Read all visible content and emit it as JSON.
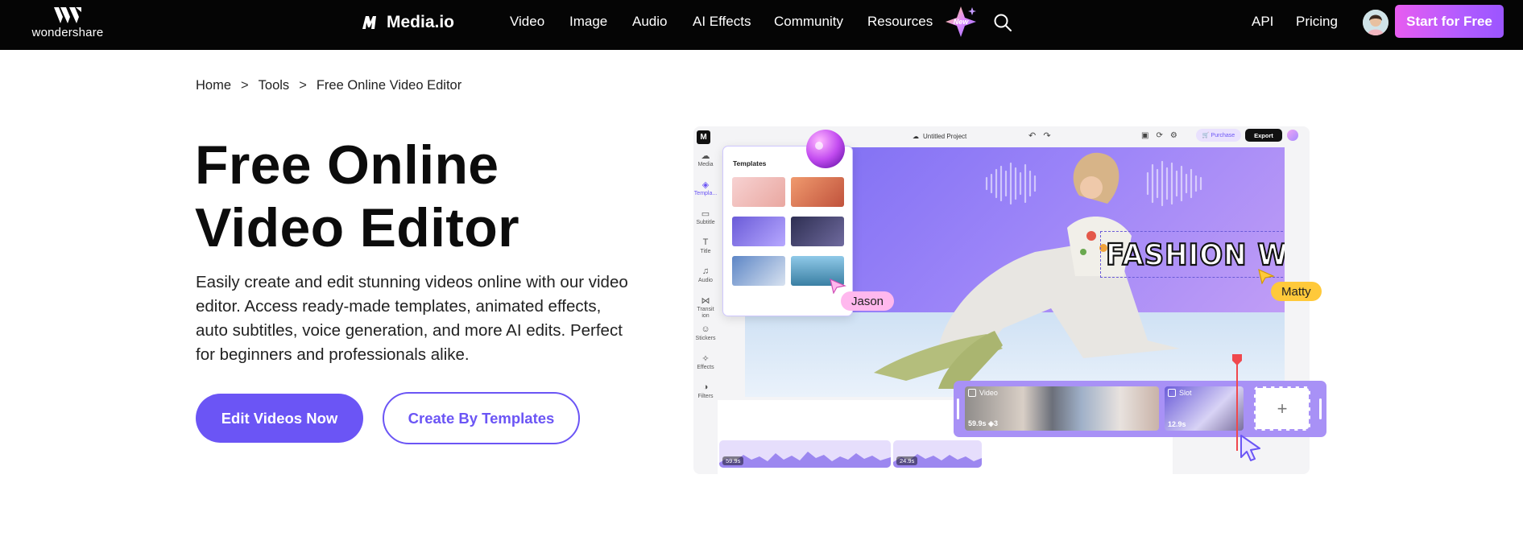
{
  "nav": {
    "ws_logo_text": "wondershare",
    "brand_name": "Media.io",
    "links": [
      "Video",
      "Image",
      "Audio",
      "AI Effects",
      "Community",
      "Resources"
    ],
    "new_badge": "New",
    "right_links": [
      "API",
      "Pricing"
    ],
    "cta": "Start for Free"
  },
  "breadcrumb": [
    "Home",
    "Tools",
    "Free Online Video Editor"
  ],
  "hero": {
    "title_line1": "Free Online",
    "title_line2": "Video Editor",
    "description": "Easily create and edit stunning videos online with our video editor. Access ready-made templates, animated effects, auto subtitles, voice generation, and more AI edits. Perfect for beginners and professionals alike.",
    "primary_button": "Edit Videos Now",
    "secondary_button": "Create By Templates"
  },
  "editor": {
    "project_name": "Untitled Project",
    "purchase": "Purchase",
    "export": "Export",
    "sidebar": [
      "Media",
      "Templa...",
      "Subtitle",
      "Title",
      "Audio",
      "Transit ion",
      "Stickers",
      "Effects",
      "Filters"
    ],
    "templates_title": "Templates",
    "canvas_text": "FASHION WEEK",
    "clips": {
      "video_label": "Video",
      "video_duration": "59.9s",
      "video_count": "3",
      "slot_label": "Slot",
      "slot_duration": "12.9s",
      "add": "+"
    },
    "audio_durations": [
      "59.9s",
      "24.9s"
    ],
    "collaborators": [
      "Jason",
      "Matty"
    ],
    "colors": {
      "accent": "#6b55f5",
      "strip": "#a891f6"
    }
  }
}
